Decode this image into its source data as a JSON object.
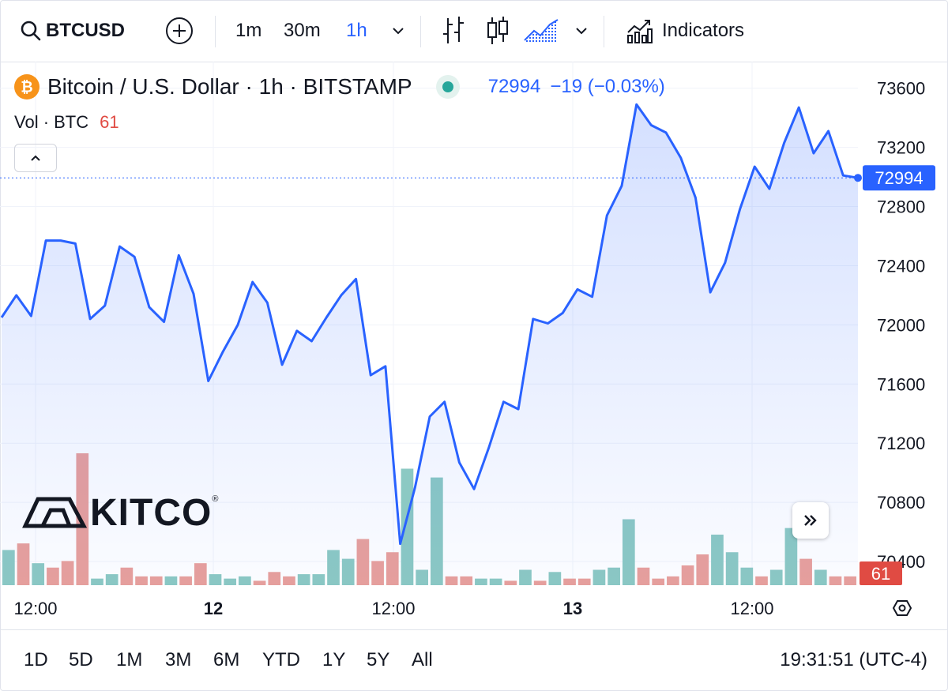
{
  "toolbar": {
    "symbol": "BTCUSD",
    "intervals": [
      "1m",
      "30m",
      "1h"
    ],
    "active_interval": "1h",
    "indicators_label": "Indicators"
  },
  "legend": {
    "title": "Bitcoin / U.S. Dollar · 1h · BITSTAMP",
    "price": "72994",
    "change": "−19 (−0.03%)",
    "vol_label": "Vol · BTC",
    "vol_value": "61"
  },
  "colors": {
    "line": "#2962ff",
    "up_volume": "#8cc9c3",
    "down_volume": "#e9a09b",
    "price_tag": "#2962ff",
    "volume_tag": "#e04b43",
    "bitcoin": "#f7931a"
  },
  "watermark": {
    "text": "KITCO"
  },
  "range_buttons": [
    "1D",
    "5D",
    "1M",
    "3M",
    "6M",
    "YTD",
    "1Y",
    "5Y",
    "All"
  ],
  "clock": "19:31:51 (UTC-4)",
  "chart_data": {
    "type": "area",
    "series": [
      {
        "values": [
          72050,
          72200,
          72060,
          72570,
          72570,
          72550,
          72040,
          72130,
          72530,
          72460,
          72120,
          72020,
          72470,
          72210,
          71620,
          71820,
          72000,
          72290,
          72150,
          71730,
          71960,
          71890,
          72050,
          72200,
          72310,
          71660,
          71720,
          70520,
          70900,
          71380,
          71480,
          71070,
          70890,
          71170,
          71480,
          71430,
          72040,
          72010,
          72080,
          72240,
          72190,
          72740,
          72940,
          73490,
          73350,
          73300,
          73130,
          72860,
          72220,
          72420,
          72780,
          73070,
          72920,
          73230,
          73470,
          73160,
          73310,
          73010,
          72994
        ]
      }
    ],
    "volume": [
      {
        "value": 16,
        "dir": "up"
      },
      {
        "value": 19,
        "dir": "down"
      },
      {
        "value": 10,
        "dir": "up"
      },
      {
        "value": 8,
        "dir": "down"
      },
      {
        "value": 11,
        "dir": "down"
      },
      {
        "value": 60,
        "dir": "down"
      },
      {
        "value": 3,
        "dir": "up"
      },
      {
        "value": 5,
        "dir": "up"
      },
      {
        "value": 8,
        "dir": "down"
      },
      {
        "value": 4,
        "dir": "down"
      },
      {
        "value": 4,
        "dir": "down"
      },
      {
        "value": 4,
        "dir": "up"
      },
      {
        "value": 4,
        "dir": "down"
      },
      {
        "value": 10,
        "dir": "down"
      },
      {
        "value": 5,
        "dir": "up"
      },
      {
        "value": 3,
        "dir": "up"
      },
      {
        "value": 4,
        "dir": "up"
      },
      {
        "value": 2,
        "dir": "down"
      },
      {
        "value": 6,
        "dir": "down"
      },
      {
        "value": 4,
        "dir": "down"
      },
      {
        "value": 5,
        "dir": "up"
      },
      {
        "value": 5,
        "dir": "up"
      },
      {
        "value": 16,
        "dir": "up"
      },
      {
        "value": 12,
        "dir": "up"
      },
      {
        "value": 21,
        "dir": "down"
      },
      {
        "value": 11,
        "dir": "down"
      },
      {
        "value": 15,
        "dir": "down"
      },
      {
        "value": 53,
        "dir": "up"
      },
      {
        "value": 7,
        "dir": "up"
      },
      {
        "value": 49,
        "dir": "up"
      },
      {
        "value": 4,
        "dir": "down"
      },
      {
        "value": 4,
        "dir": "down"
      },
      {
        "value": 3,
        "dir": "up"
      },
      {
        "value": 3,
        "dir": "up"
      },
      {
        "value": 2,
        "dir": "down"
      },
      {
        "value": 7,
        "dir": "up"
      },
      {
        "value": 2,
        "dir": "down"
      },
      {
        "value": 6,
        "dir": "up"
      },
      {
        "value": 3,
        "dir": "down"
      },
      {
        "value": 3,
        "dir": "down"
      },
      {
        "value": 7,
        "dir": "up"
      },
      {
        "value": 8,
        "dir": "up"
      },
      {
        "value": 30,
        "dir": "up"
      },
      {
        "value": 8,
        "dir": "down"
      },
      {
        "value": 3,
        "dir": "down"
      },
      {
        "value": 4,
        "dir": "down"
      },
      {
        "value": 9,
        "dir": "down"
      },
      {
        "value": 14,
        "dir": "down"
      },
      {
        "value": 23,
        "dir": "up"
      },
      {
        "value": 15,
        "dir": "up"
      },
      {
        "value": 8,
        "dir": "up"
      },
      {
        "value": 4,
        "dir": "down"
      },
      {
        "value": 7,
        "dir": "up"
      },
      {
        "value": 26,
        "dir": "up"
      },
      {
        "value": 12,
        "dir": "down"
      },
      {
        "value": 7,
        "dir": "up"
      },
      {
        "value": 4,
        "dir": "down"
      },
      {
        "value": 4,
        "dir": "down"
      }
    ],
    "y_ticks": [
      73600,
      73200,
      72800,
      72400,
      72000,
      71600,
      71200,
      70800,
      70400
    ],
    "ylim": [
      70240,
      73780
    ],
    "x_ticks": [
      {
        "label": "12:00",
        "bold": false
      },
      {
        "label": "12",
        "bold": true
      },
      {
        "label": "12:00",
        "bold": false
      },
      {
        "label": "13",
        "bold": true
      },
      {
        "label": "12:00",
        "bold": false
      }
    ],
    "last_price": "72994",
    "last_volume": "61",
    "grid": true
  }
}
